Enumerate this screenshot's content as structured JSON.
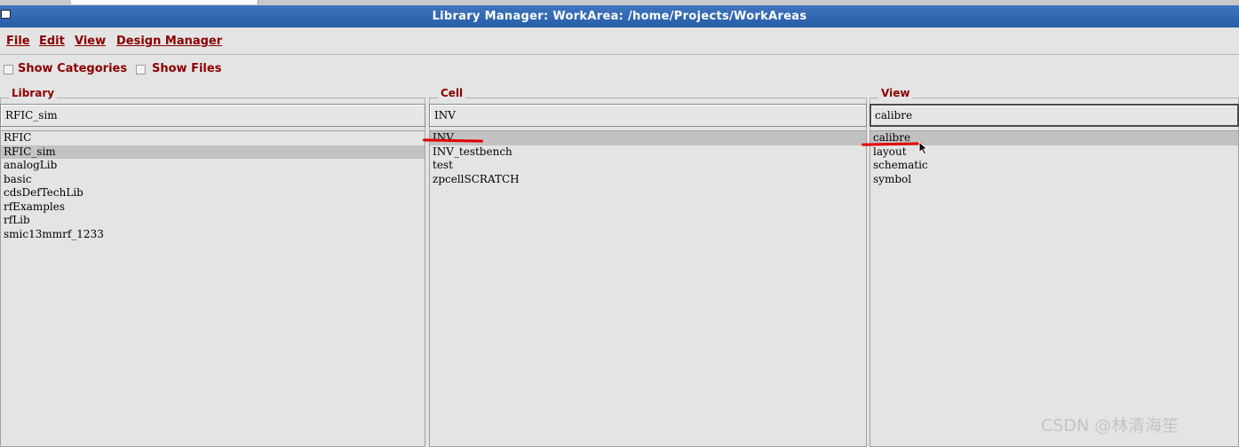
{
  "window": {
    "title": "Library Manager: WorkArea: /home/Projects/WorkAreas"
  },
  "menu": {
    "file": "File",
    "edit": "Edit",
    "view": "View",
    "design_manager": "Design Manager"
  },
  "options": {
    "show_categories": "Show Categories",
    "show_files": "Show Files"
  },
  "library": {
    "title": "Library",
    "value": "RFIC_sim",
    "items": [
      "RFIC",
      "RFIC_sim",
      "analogLib",
      "basic",
      "cdsDefTechLib",
      "rfExamples",
      "rfLib",
      "smic13mmrf_1233"
    ],
    "selected": 1
  },
  "cell": {
    "title": "Cell",
    "value": "INV",
    "items": [
      "INV",
      "INV_testbench",
      "test",
      "zpcellSCRATCH"
    ],
    "selected": 0
  },
  "view": {
    "title": "View",
    "value": "calibre",
    "items": [
      "calibre",
      "layout",
      "schematic",
      "symbol"
    ],
    "selected": 0
  },
  "colors": {
    "titlebar": "#2f66b3",
    "label_text": "#8b0000",
    "selection": "#c2c2c2",
    "annotation": "#e00000"
  },
  "watermark": "CSDN @林清海笙"
}
